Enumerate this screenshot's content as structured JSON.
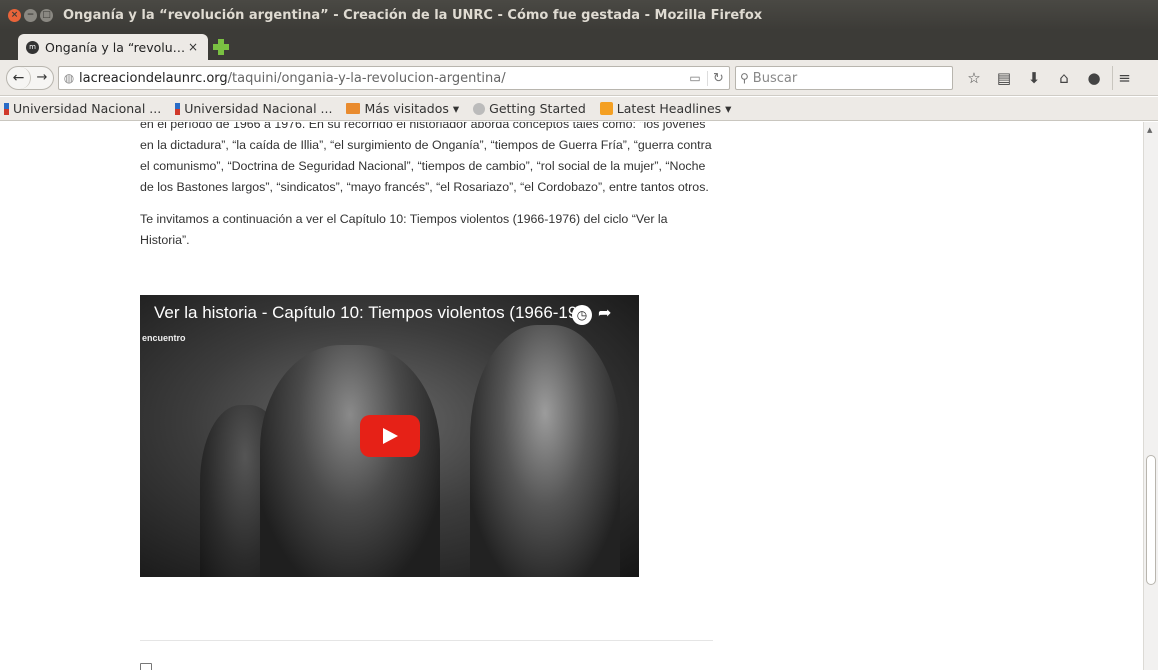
{
  "window": {
    "title": "Onganía y la “revolución argentina” - Creación de la UNRC - Cómo fue gestada - Mozilla Firefox",
    "close_glyph": "×",
    "min_glyph": "−",
    "max_glyph": "□"
  },
  "tab": {
    "title": "Onganía y la “revolu…",
    "close_glyph": "×",
    "favicon_letter": "m"
  },
  "navbar": {
    "back_glyph": "←",
    "forward_glyph": "→",
    "url_host": "lacreaciondelaunrc.org",
    "url_path": "/taquini/ongania-y-la-revolucion-argentina/",
    "reader_glyph": "▭",
    "reload_glyph": "↻",
    "search_placeholder": "Buscar",
    "search_glyph": "⚲",
    "icons": {
      "bookmark_star": "☆",
      "bookmarks_list": "▤",
      "downloads": "⬇",
      "home": "⌂",
      "chat": "●",
      "menu": "≡"
    }
  },
  "bookmarks": [
    {
      "label": "Universidad Nacional ...",
      "icon": "unl"
    },
    {
      "label": "Universidad Nacional ...",
      "icon": "unl"
    },
    {
      "label": "Más visitados ▾",
      "icon": "folder"
    },
    {
      "label": "Getting Started",
      "icon": "globe"
    },
    {
      "label": "Latest Headlines ▾",
      "icon": "rss"
    }
  ],
  "article": {
    "paragraph1_partial": "en el período de 1966 a 1976. En su recorrido el historiador aborda conceptos tales como: “los jóvenes en la dictadura”, “la caída de Illia”, “el surgimiento de Onganía”, “tiempos de Guerra Fría”, “guerra contra el comunismo”, “Doctrina de Seguridad Nacional”, “tiempos de cambio”, “rol social de la mujer”, “Noche de los Bastones largos”, “sindicatos”, “mayo francés”, “el Rosariazo”, “el Cordobazo”, entre tantos otros.",
    "paragraph2": "Te invitamos a continuación a ver el Capítulo 10: Tiempos violentos (1966-1976) del ciclo “Ver la Historia”."
  },
  "video": {
    "title": "Ver la historia - Capítulo 10: Tiempos violentos (1966-19...",
    "channel": "encuentro",
    "watch_later_glyph": "◷",
    "share_glyph": "➦"
  },
  "colors": {
    "titlebar": "#3c3b37",
    "chrome": "#edeae6",
    "youtube_red": "#e62117",
    "text": "#333333"
  }
}
